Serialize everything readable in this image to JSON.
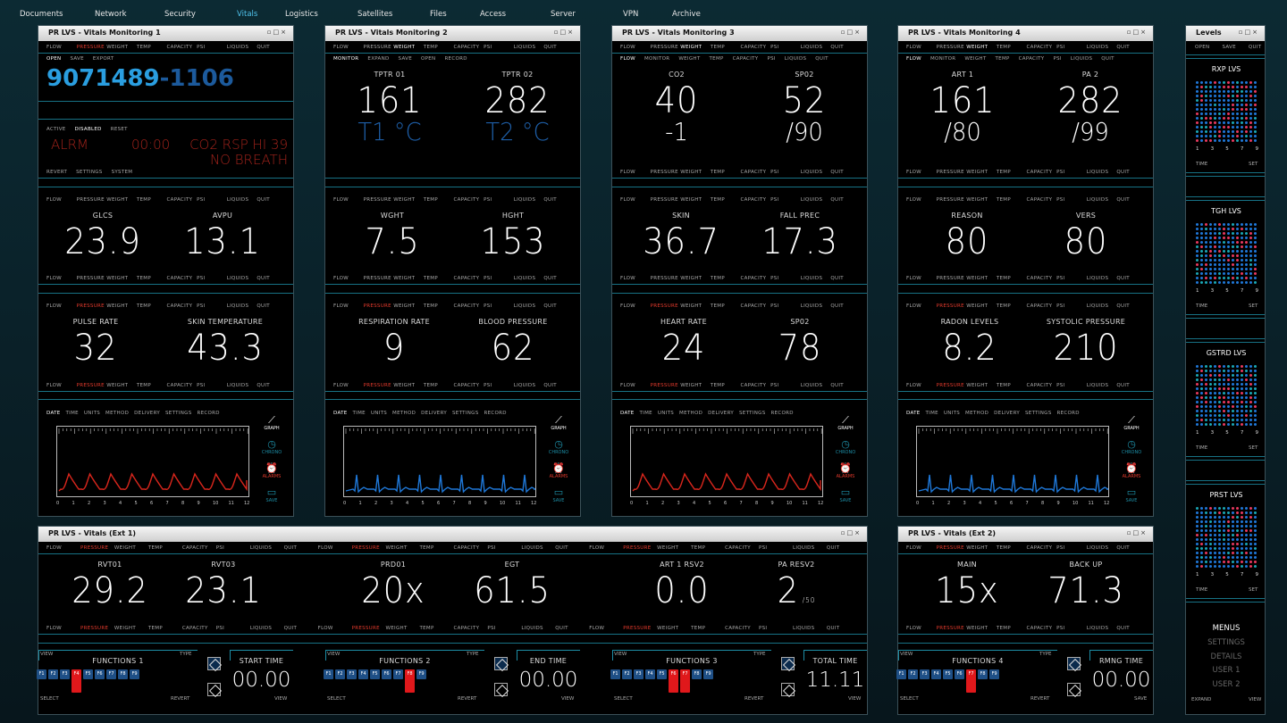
{
  "topnav": [
    "Documents",
    "Network",
    "Security",
    "Vitals",
    "Logistics",
    "Satellites",
    "Files",
    "Access",
    "Server",
    "VPN",
    "Archive"
  ],
  "active_nav": "Vitals",
  "menu_bar": [
    "FLOW",
    "PRESSURE",
    "WEIGHT",
    "TEMP",
    "CAPACITY",
    "PSI",
    "LIQUIDS",
    "QUIT"
  ],
  "sub_menu": [
    "MONITOR",
    "EXPAND",
    "SAVE",
    "OPEN",
    "RECORD"
  ],
  "sub_menu3": [
    "FLOW",
    "MONITOR",
    "WEIGHT",
    "TEMP",
    "CAPACITY",
    "PSI",
    "LIQUIDS",
    "QUIT"
  ],
  "graph_menu": [
    "DATE",
    "TIME",
    "UNITS",
    "METHOD",
    "DELIVERY",
    "SETTINGS",
    "RECORD"
  ],
  "graph_ticks": [
    "0",
    "1",
    "2",
    "3",
    "4",
    "5",
    "6",
    "7",
    "8",
    "9",
    "10",
    "11",
    "12"
  ],
  "graph_tools": {
    "graph": "GRAPH",
    "chrono": "CHRONO",
    "alarms": "ALARMS",
    "save": "SAVE"
  },
  "w1": {
    "title": "PR LVS - Vitals Monitoring 1",
    "file_menu": [
      "OPEN",
      "SAVE",
      "EXPORT"
    ],
    "id_main": "9071489",
    "id_suffix": "-1106",
    "state_menu": [
      "ACTIVE",
      "DISABLED",
      "RESET"
    ],
    "alarm": {
      "label": "ALRM",
      "time": "00:00",
      "msg1": "CO2 RSP HI 39",
      "msg2": "NO BREATH"
    },
    "bottom_menu": [
      "REVERT",
      "SETTINGS",
      "SYSTEM"
    ],
    "r2": [
      {
        "label": "GLCS",
        "value": "23.9"
      },
      {
        "label": "AVPU",
        "value": "13.1"
      }
    ],
    "r3": [
      {
        "label": "PULSE RATE",
        "value": "32"
      },
      {
        "label": "SKIN TEMPERATURE",
        "value": "43.3"
      }
    ]
  },
  "w2": {
    "title": "PR LVS - Vitals Monitoring 2",
    "r1": [
      {
        "label": "TPTR 01",
        "value": "161",
        "sub": "T1 °C"
      },
      {
        "label": "TPTR 02",
        "value": "282",
        "sub": "T2 °C"
      }
    ],
    "r2": [
      {
        "label": "WGHT",
        "value": "7.5"
      },
      {
        "label": "HGHT",
        "value": "153"
      }
    ],
    "r3": [
      {
        "label": "RESPIRATION RATE",
        "value": "9"
      },
      {
        "label": "BLOOD PRESSURE",
        "value": "62"
      }
    ]
  },
  "w3": {
    "title": "PR LVS - Vitals Monitoring 3",
    "r1": [
      {
        "label": "CO2",
        "value": "40",
        "sub": "-1"
      },
      {
        "label": "SP02",
        "value": "52",
        "sub": "/90"
      }
    ],
    "r2": [
      {
        "label": "SKIN",
        "value": "36.7"
      },
      {
        "label": "FALL PREC",
        "value": "17.3"
      }
    ],
    "r3": [
      {
        "label": "HEART RATE",
        "value": "24"
      },
      {
        "label": "SP02",
        "value": "78"
      }
    ]
  },
  "w4": {
    "title": "PR LVS - Vitals Monitoring 4",
    "r1": [
      {
        "label": "ART 1",
        "value": "161",
        "sub": "/80"
      },
      {
        "label": "PA 2",
        "value": "282",
        "sub": "/99"
      }
    ],
    "r2": [
      {
        "label": "REASON",
        "value": "80"
      },
      {
        "label": "VERS",
        "value": "80"
      }
    ],
    "r3": [
      {
        "label": "RADON LEVELS",
        "value": "8.2"
      },
      {
        "label": "SYSTOLIC PRESSURE",
        "value": "210"
      }
    ]
  },
  "ext1": {
    "title": "PR LVS - Vitals (Ext 1)",
    "cells": [
      {
        "label": "RVT01",
        "value": "29.2"
      },
      {
        "label": "RVT03",
        "value": "23.1"
      },
      {
        "label": "PRD01",
        "value": "20x"
      },
      {
        "label": "EGT",
        "value": "61.5"
      },
      {
        "label": "ART 1 RSV2",
        "value": "0.0"
      },
      {
        "label": "PA RESV2",
        "value": "2",
        "unit": "/50"
      }
    ]
  },
  "ext2": {
    "title": "PR LVS - Vitals (Ext 2)",
    "cells": [
      {
        "label": "MAIN",
        "value": "15x"
      },
      {
        "label": "BACK UP",
        "value": "71.3"
      }
    ]
  },
  "functions": [
    {
      "title": "FUNCTIONS 1",
      "view": "VIEW",
      "type": "TYPE",
      "select": "SELECT",
      "revert": "REVERT",
      "time_label": "START TIME",
      "time": "00.00",
      "time_action": "VIEW"
    },
    {
      "title": "FUNCTIONS 2",
      "view": "VIEW",
      "type": "TYPE",
      "select": "SELECT",
      "revert": "REVERT",
      "time_label": "END TIME",
      "time": "00.00",
      "time_action": "VIEW"
    },
    {
      "title": "FUNCTIONS 3",
      "view": "VIEW",
      "type": "TYPE",
      "select": "SELECT",
      "revert": "REVERT",
      "time_label": "TOTAL TIME",
      "time": "11.11",
      "time_action": "VIEW"
    },
    {
      "title": "FUNCTIONS 4",
      "view": "VIEW",
      "type": "TYPE",
      "select": "SELECT",
      "revert": "REVERT",
      "time_label": "RMNG TIME",
      "time": "00.00",
      "time_action": "SAVE"
    }
  ],
  "fkeys": [
    "F1",
    "F2",
    "F3",
    "F4",
    "F5",
    "F6",
    "F7",
    "F8",
    "F9"
  ],
  "levels": {
    "title": "Levels",
    "menu": [
      "OPEN",
      "SAVE",
      "QUIT"
    ],
    "panels": [
      "RXP LVS",
      "TGH LVS",
      "GSTRD LVS",
      "PRST LVS"
    ],
    "axis": [
      "1",
      "3",
      "5",
      "7",
      "9"
    ],
    "time": "TIME",
    "set": "SET",
    "menus": [
      "MENUS",
      "SETTINGS",
      "DETAILS",
      "USER 1",
      "USER 2"
    ],
    "expand": "EXPAND",
    "view": "VIEW"
  },
  "colors": {
    "accent": "#1d8ea6",
    "active_nav": "#4fc3ec",
    "alarm_red": "#e33a2c",
    "trace_red": "#d8261c",
    "trace_blue": "#1f78d8",
    "dim_blue": "#1e5fa8"
  }
}
